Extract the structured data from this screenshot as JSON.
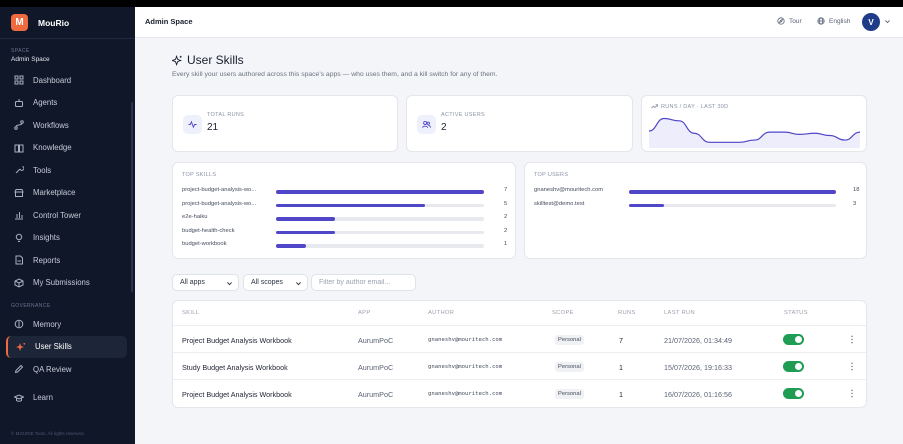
{
  "brand": {
    "logo_letter": "M",
    "name": "MouRio",
    "logo_color": "#ef6b3f"
  },
  "space": {
    "label": "SPACE",
    "name": "Admin Space"
  },
  "nav": [
    {
      "label": "Dashboard",
      "icon": "dashboard-icon"
    },
    {
      "label": "Agents",
      "icon": "bot-icon"
    },
    {
      "label": "Workflows",
      "icon": "workflow-icon"
    },
    {
      "label": "Knowledge",
      "icon": "book-icon"
    },
    {
      "label": "Tools",
      "icon": "wrench-icon"
    },
    {
      "label": "Marketplace",
      "icon": "store-icon"
    },
    {
      "label": "Control Tower",
      "icon": "bar-chart-icon"
    },
    {
      "label": "Insights",
      "icon": "lightbulb-icon"
    },
    {
      "label": "Reports",
      "icon": "file-icon"
    },
    {
      "label": "My Submissions",
      "icon": "package-icon"
    }
  ],
  "governance": {
    "label": "GOVERNANCE",
    "items": [
      {
        "label": "Memory",
        "icon": "brain-icon"
      },
      {
        "label": "User Skills",
        "icon": "sparkle-icon",
        "active": true
      },
      {
        "label": "QA Review",
        "icon": "pen-icon"
      }
    ]
  },
  "learn": {
    "label": "Learn",
    "icon": "graduation-cap-icon"
  },
  "sidebar_footer": "© MOURIE Tools. All rights reserved.",
  "header": {
    "title": "Admin Space",
    "tour_label": "Tour",
    "language_label": "English",
    "avatar_letter": "V"
  },
  "page": {
    "title": "User Skills",
    "subtitle": "Every skill your users authored across this space's apps — who uses them, and a kill switch for any of them."
  },
  "stats": {
    "total_runs": {
      "label": "TOTAL RUNS",
      "value": "21"
    },
    "active_users": {
      "label": "ACTIVE USERS",
      "value": "2"
    },
    "runs_per_day": {
      "label": "RUNS / DAY · LAST 30D"
    }
  },
  "chart_data": {
    "type": "area",
    "values": [
      1.5,
      2.6,
      2.4,
      1.3,
      0.5,
      0.5,
      0.5,
      0.7,
      1.4,
      1.4,
      1.2,
      1.3,
      1.1,
      0.7,
      1.4
    ]
  },
  "top_skills": {
    "title": "TOP SKILLS",
    "max": 7,
    "items": [
      {
        "name": "project-budget-analysis-wo...",
        "count": 7
      },
      {
        "name": "project-budget-analysis-wo...",
        "count": 5
      },
      {
        "name": "e2e-haiku",
        "count": 2
      },
      {
        "name": "budget-health-check",
        "count": 2
      },
      {
        "name": "budget-workbook",
        "count": 1
      }
    ]
  },
  "top_users": {
    "title": "TOP USERS",
    "max": 18,
    "items": [
      {
        "name": "gnaneshv@mouritech.com",
        "count": 18
      },
      {
        "name": "skilltest@demo.test",
        "count": 3
      }
    ]
  },
  "filters": {
    "apps": "All apps",
    "scopes": "All scopes",
    "author_placeholder": "Filter by author email..."
  },
  "table": {
    "columns": [
      "SKILL",
      "APP",
      "AUTHOR",
      "SCOPE",
      "RUNS",
      "LAST RUN",
      "STATUS"
    ],
    "rows": [
      {
        "skill": "Project Budget Analysis Workbook",
        "app": "AurumPoC",
        "author": "gnaneshv@mouritech.com",
        "scope": "Personal",
        "runs": "7",
        "last_run": "21/07/2026, 01:34:49",
        "status": true
      },
      {
        "skill": "Study Budget Analysis Workbook",
        "app": "AurumPoC",
        "author": "gnaneshv@mouritech.com",
        "scope": "Personal",
        "runs": "1",
        "last_run": "15/07/2026, 19:16:33",
        "status": true
      },
      {
        "skill": "Project Budget Analysis Workbook",
        "app": "AurumPoC",
        "author": "gnaneshv@mouritech.com",
        "scope": "Personal",
        "runs": "1",
        "last_run": "16/07/2026, 01:16:56",
        "status": true
      }
    ]
  },
  "colors": {
    "accent": "#4f46c8",
    "toggle_on": "#1f9d55",
    "sidebar_bg": "#0f1729"
  }
}
